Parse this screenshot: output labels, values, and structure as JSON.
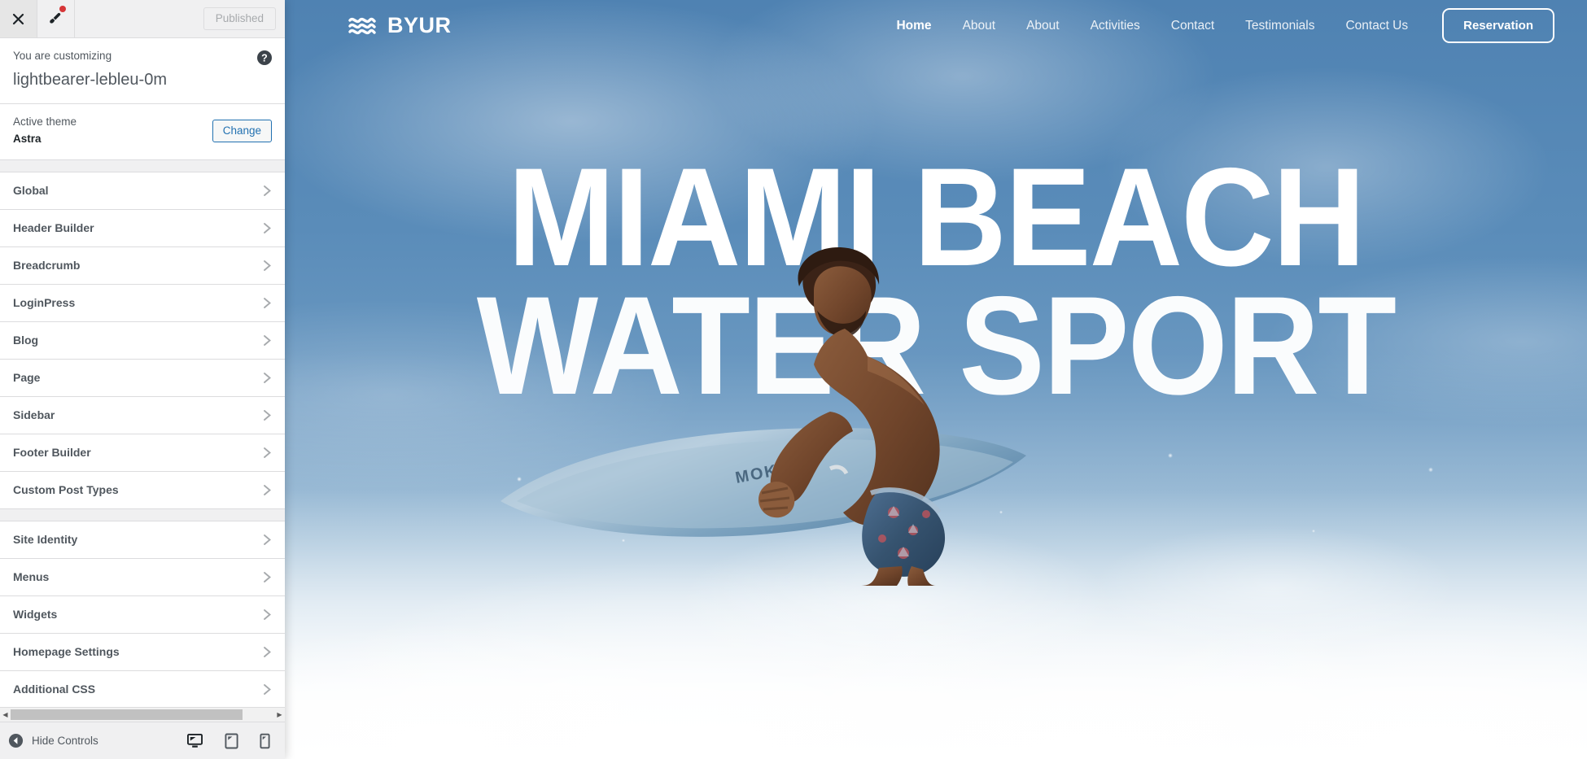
{
  "customizer": {
    "topbar": {
      "close_icon": "close-x-icon",
      "brush_icon": "paintbrush-icon",
      "has_notification_dot": true,
      "publish_label": "Published"
    },
    "info": {
      "customizing_label": "You are customizing",
      "site_title": "lightbearer-lebleu-0m",
      "help_icon": "help-question-icon"
    },
    "theme": {
      "active_theme_label": "Active theme",
      "theme_name": "Astra",
      "change_label": "Change"
    },
    "sections": [
      {
        "label": "Global",
        "chevron": "chevron-right-icon"
      },
      {
        "label": "Header Builder",
        "chevron": "chevron-right-icon"
      },
      {
        "label": "Breadcrumb",
        "chevron": "chevron-right-icon"
      },
      {
        "label": "LoginPress",
        "chevron": "chevron-right-icon"
      },
      {
        "label": "Blog",
        "chevron": "chevron-right-icon"
      },
      {
        "label": "Page",
        "chevron": "chevron-right-icon"
      },
      {
        "label": "Sidebar",
        "chevron": "chevron-right-icon"
      },
      {
        "label": "Footer Builder",
        "chevron": "chevron-right-icon"
      },
      {
        "label": "Custom Post Types",
        "chevron": "chevron-right-icon"
      },
      {
        "label": "Site Identity",
        "chevron": "chevron-right-icon"
      },
      {
        "label": "Menus",
        "chevron": "chevron-right-icon"
      },
      {
        "label": "Widgets",
        "chevron": "chevron-right-icon"
      },
      {
        "label": "Homepage Settings",
        "chevron": "chevron-right-icon"
      },
      {
        "label": "Additional CSS",
        "chevron": "chevron-right-icon"
      }
    ],
    "group_separator_after_index": 8,
    "footer": {
      "collapse_icon": "collapse-left-arrow-icon",
      "hide_controls_label": "Hide Controls",
      "devices": [
        {
          "name": "desktop-preview",
          "icon": "desktop-icon",
          "active": true
        },
        {
          "name": "tablet-preview",
          "icon": "tablet-icon",
          "active": false
        },
        {
          "name": "mobile-preview",
          "icon": "mobile-icon",
          "active": false
        }
      ]
    },
    "scrollbar": {
      "left_arrow_icon": "scroll-left-arrow-icon",
      "right_arrow_icon": "scroll-right-arrow-icon"
    }
  },
  "preview": {
    "header": {
      "logo_icon": "wave-logo-icon",
      "brand_name": "BYUR",
      "nav": [
        {
          "label": "Home",
          "active": true
        },
        {
          "label": "About",
          "active": false
        },
        {
          "label": "About",
          "active": false
        },
        {
          "label": "Activities",
          "active": false
        },
        {
          "label": "Contact",
          "active": false
        },
        {
          "label": "Testimonials",
          "active": false
        },
        {
          "label": "Contact Us",
          "active": false
        }
      ],
      "cta_label": "Reservation"
    },
    "hero": {
      "line1": "MIAMI BEACH",
      "line2": "WATER SPORT",
      "image_alt": "surfer-riding-wave"
    }
  },
  "colors": {
    "sky_blue": "#5b89b5",
    "deep_blue": "#4f82b2",
    "foam_white": "#ffffff",
    "wp_blue": "#2271b1",
    "wp_gray_bg": "#f0f0f1",
    "wp_border": "#dcdcde",
    "wp_text": "#50575e",
    "notification_red": "#d63638"
  }
}
